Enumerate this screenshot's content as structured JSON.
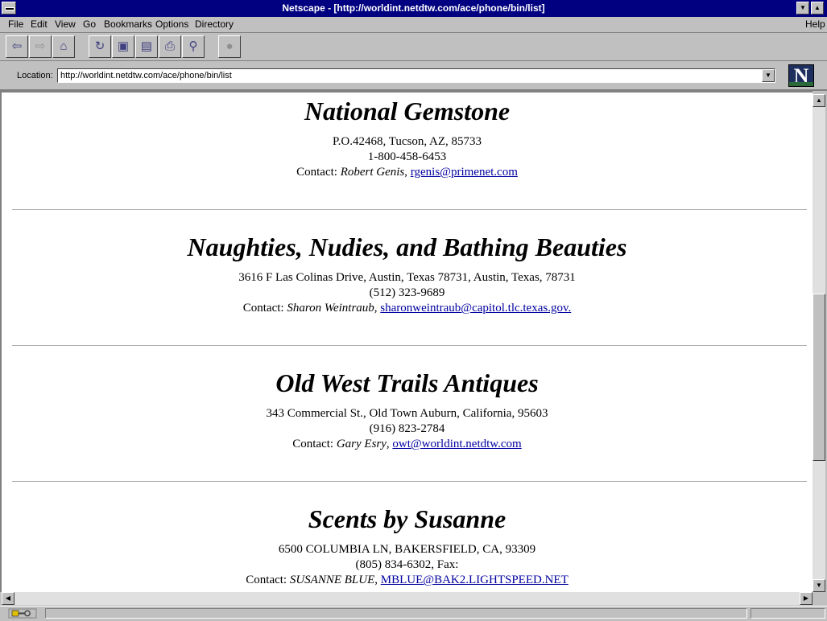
{
  "window": {
    "title": "Netscape - [http://worldint.netdtw.com/ace/phone/bin/list]"
  },
  "menu": [
    {
      "label": "File"
    },
    {
      "label": "Edit"
    },
    {
      "label": "View"
    },
    {
      "label": "Go"
    },
    {
      "label": "Bookmarks"
    },
    {
      "label": "Options"
    },
    {
      "label": "Directory"
    }
  ],
  "help_menu": {
    "label": "Help"
  },
  "toolbar": {
    "buttons": [
      {
        "icon": "back-icon",
        "glyph": "⇦"
      },
      {
        "icon": "forward-icon",
        "glyph": "⇨"
      },
      {
        "icon": "home-icon",
        "glyph": "⌂"
      },
      {
        "icon": "reload-icon",
        "glyph": "↻"
      },
      {
        "icon": "images-icon",
        "glyph": "▣"
      },
      {
        "icon": "open-icon",
        "glyph": "▤"
      },
      {
        "icon": "print-icon",
        "glyph": "⎙"
      },
      {
        "icon": "find-icon",
        "glyph": "⚲"
      },
      {
        "icon": "stop-icon",
        "glyph": "●"
      }
    ]
  },
  "location": {
    "label": "Location:",
    "url": "http://worldint.netdtw.com/ace/phone/bin/list"
  },
  "logo": {
    "letter": "N"
  },
  "listings": [
    {
      "name": "National Gemstone",
      "address": "P.O.42468, Tucson, AZ, 85733",
      "phone": "1-800-458-6453",
      "contact_prefix": "Contact: ",
      "contact_name": "Robert Genis",
      "separator": ", ",
      "email": "rgenis@primenet.com"
    },
    {
      "name": "Naughties, Nudies, and Bathing Beauties",
      "address": "3616 F Las Colinas Drive, Austin, Texas 78731, Austin, Texas, 78731",
      "phone": "(512) 323-9689",
      "contact_prefix": "Contact: ",
      "contact_name": "Sharon Weintraub",
      "separator": ", ",
      "email": "sharonweintraub@capitol.tlc.texas.gov."
    },
    {
      "name": "Old West Trails Antiques",
      "address": "343 Commercial St., Old Town Auburn, California, 95603",
      "phone": "(916) 823-2784",
      "contact_prefix": "Contact: ",
      "contact_name": "Gary Esry",
      "separator": ", ",
      "email": "owt@worldint.netdtw.com"
    },
    {
      "name": "Scents by Susanne",
      "address": "6500 COLUMBIA LN, BAKERSFIELD, CA, 93309",
      "phone": "(805) 834-6302, Fax:",
      "contact_prefix": "Contact: ",
      "contact_name": "SUSANNE BLUE",
      "separator": ", ",
      "email": "MBLUE@BAK2.LIGHTSPEED.NET"
    }
  ],
  "colors": {
    "titlebar": "#000080",
    "chrome": "#c0c0c0",
    "link": "#0000a0"
  }
}
